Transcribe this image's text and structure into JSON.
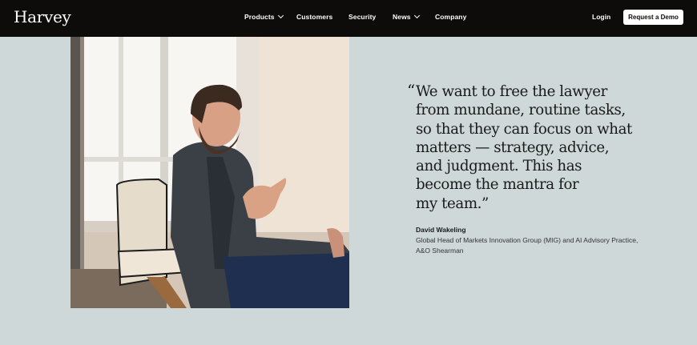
{
  "brand": {
    "logo": "Harvey"
  },
  "nav": {
    "items": [
      {
        "label": "Products",
        "has_dropdown": true
      },
      {
        "label": "Customers",
        "has_dropdown": false
      },
      {
        "label": "Security",
        "has_dropdown": false
      },
      {
        "label": "News",
        "has_dropdown": true
      },
      {
        "label": "Company",
        "has_dropdown": false
      }
    ],
    "login": "Login",
    "cta": "Request a Demo"
  },
  "testimonial": {
    "open_quote": "“",
    "quote": "We want to free the lawyer\nfrom mundane, routine tasks,\nso that they can focus on what\nmatters — strategy, advice,\nand judgment. This has\nbecome the mantra for\nmy team.”",
    "author": "David Wakeling",
    "role": "Global Head of Markets Innovation Group (MIG) and AI Advisory Practice, A&O Shearman"
  },
  "colors": {
    "nav_bg": "#0e0c0b",
    "page_bg": "#cfd8d8",
    "text": "#1a1a1a"
  }
}
